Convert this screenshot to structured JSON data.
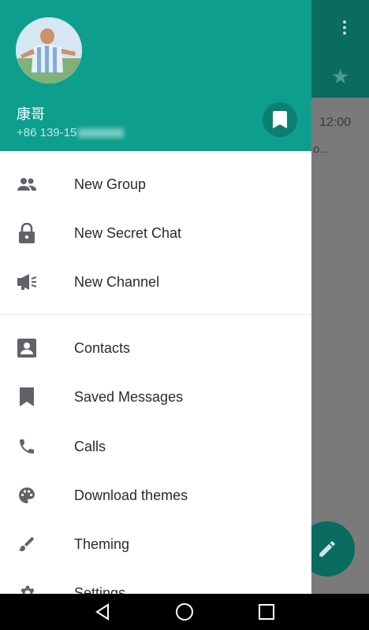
{
  "profile": {
    "name": "康哥",
    "phone": "+86 139-15"
  },
  "background": {
    "time": "12:00",
    "snippet": "o..."
  },
  "menu": {
    "new_group": "New Group",
    "new_secret_chat": "New Secret Chat",
    "new_channel": "New Channel",
    "contacts": "Contacts",
    "saved_messages": "Saved Messages",
    "calls": "Calls",
    "download_themes": "Download themes",
    "theming": "Theming",
    "settings": "Settings"
  },
  "icons": {
    "new_group": "group-icon",
    "new_secret_chat": "lock-icon",
    "new_channel": "megaphone-icon",
    "contacts": "contact-card-icon",
    "saved_messages": "bookmark-icon",
    "calls": "phone-icon",
    "download_themes": "palette-icon",
    "theming": "brush-icon",
    "settings": "gear-icon"
  },
  "colors": {
    "header": "#0e9e8e",
    "header_dark": "#0a6b60",
    "icon_gray": "#5f6368",
    "label": "#2b2b2b"
  }
}
